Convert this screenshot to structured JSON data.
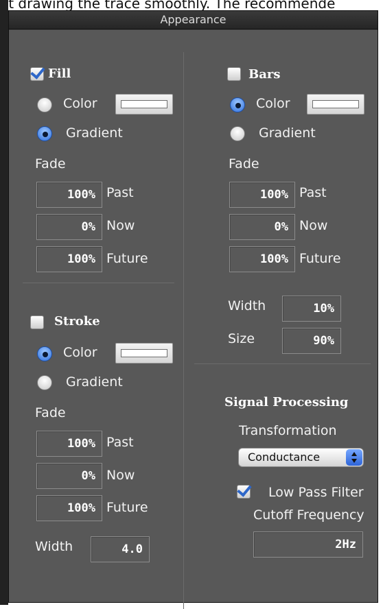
{
  "header_text": "ot drawing the trace smoothly. The recommende",
  "window": {
    "title": "Appearance"
  },
  "fill": {
    "label": "Fill",
    "checked": true,
    "color_label": "Color",
    "gradient_label": "Gradient",
    "selected": "Gradient",
    "fade_label": "Fade",
    "fade": [
      {
        "value": "100%",
        "label": "Past"
      },
      {
        "value": "0%",
        "label": "Now"
      },
      {
        "value": "100%",
        "label": "Future"
      }
    ]
  },
  "stroke": {
    "label": "Stroke",
    "checked": false,
    "color_label": "Color",
    "gradient_label": "Gradient",
    "selected": "Color",
    "fade_label": "Fade",
    "fade": [
      {
        "value": "100%",
        "label": "Past"
      },
      {
        "value": "0%",
        "label": "Now"
      },
      {
        "value": "100%",
        "label": "Future"
      }
    ],
    "width_label": "Width",
    "width_value": "4.0"
  },
  "bars": {
    "label": "Bars",
    "checked": false,
    "color_label": "Color",
    "gradient_label": "Gradient",
    "selected": "Color",
    "fade_label": "Fade",
    "fade": [
      {
        "value": "100%",
        "label": "Past"
      },
      {
        "value": "0%",
        "label": "Now"
      },
      {
        "value": "100%",
        "label": "Future"
      }
    ],
    "width_label": "Width",
    "width_value": "10%",
    "size_label": "Size",
    "size_value": "90%"
  },
  "signal": {
    "heading": "Signal Processing",
    "transformation_label": "Transformation",
    "transformation_value": "Conductance",
    "low_pass_label": "Low Pass Filter",
    "low_pass_checked": true,
    "cutoff_label": "Cutoff Frequency",
    "cutoff_value": "2Hz"
  },
  "colors": {
    "panel": "#585858",
    "titlebar": "#2e2e2e",
    "accent": "#2e67c9"
  }
}
